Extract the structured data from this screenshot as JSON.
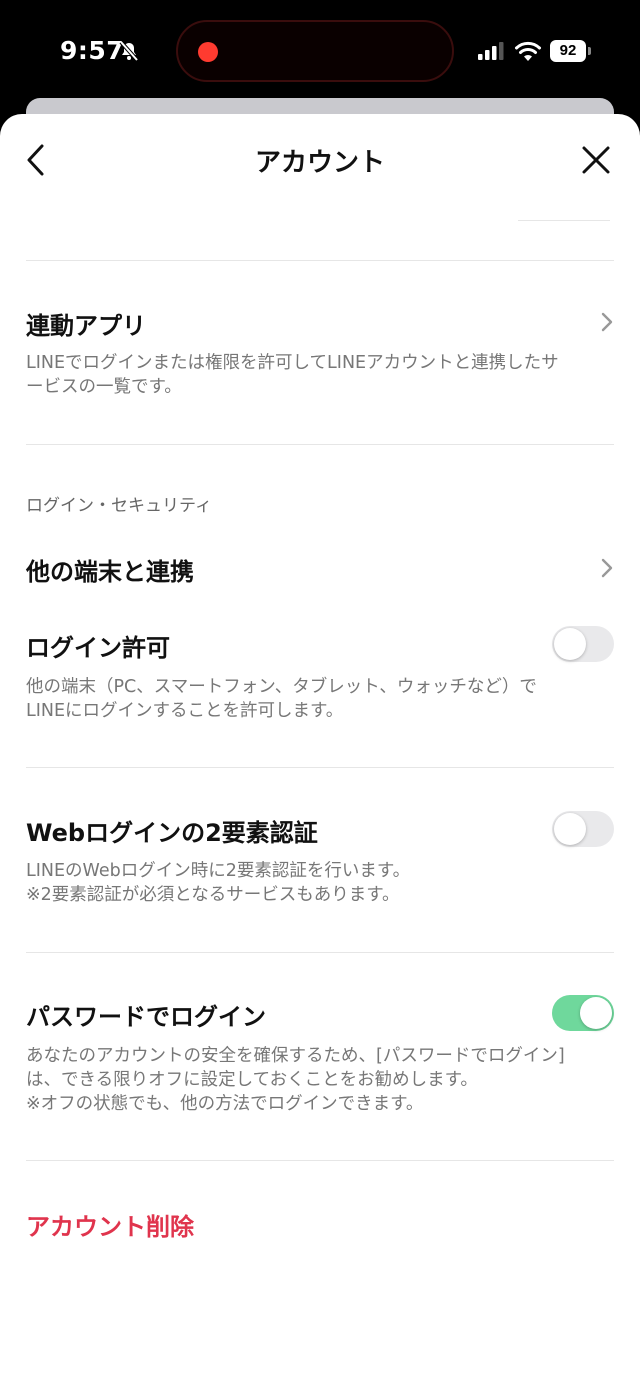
{
  "status_bar": {
    "time": "9:57",
    "battery": "92",
    "icons": [
      "bell-slash-icon",
      "signal-icon",
      "wifi-icon",
      "battery-icon"
    ]
  },
  "nav": {
    "title": "アカウント",
    "back_icon": "chevron-left-icon",
    "close_icon": "close-icon"
  },
  "linked_apps": {
    "title": "連動アプリ",
    "description": "LINEでログインまたは権限を許可してLINEアカウントと連携したサ\nービスの一覧です。"
  },
  "login_security": {
    "header": "ログイン・セキュリティ",
    "other_devices": {
      "title": "他の端末と連携"
    },
    "login_permission": {
      "title": "ログイン許可",
      "description": "他の端末（PC、スマートフォン、タブレット、ウォッチなど）で\nLINEにログインすることを許可します。",
      "enabled": false
    },
    "web_2fa": {
      "title": "Webログインの2要素認証",
      "description": "LINEのWebログイン時に2要素認証を行います。\n※2要素認証が必須となるサービスもあります。",
      "enabled": false
    },
    "password_login": {
      "title": "パスワードでログイン",
      "description": "あなたのアカウントの安全を確保するため、[パスワードでログイン]\nは、できる限りオフに設定しておくことをお勧めします。\n※オフの状態でも、他の方法でログインできます。",
      "enabled": true
    }
  },
  "delete_account": {
    "label": "アカウント削除"
  },
  "colors": {
    "accent_green": "#6fd89c",
    "danger_red": "#e0344d",
    "recording_red": "#ff3b30"
  }
}
